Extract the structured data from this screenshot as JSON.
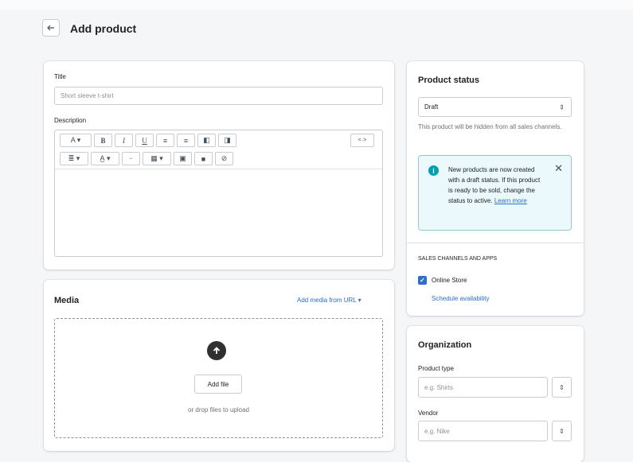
{
  "page": {
    "title": "Add product"
  },
  "product": {
    "title_label": "Title",
    "title_placeholder": "Short sleeve t-shirt",
    "description_label": "Description",
    "toolbar": {
      "row1": [
        "A ▾",
        "B",
        "I",
        "U",
        "≡",
        "≡",
        "◧",
        "◨"
      ],
      "html_toggle": "<·>",
      "row2": [
        "≣ ▾",
        "A̲ ▾",
        "⌁",
        "▦ ▾",
        "▣",
        "■",
        "⊘"
      ]
    }
  },
  "media": {
    "title": "Media",
    "add_url_link": "Add media from URL ▾",
    "add_file_button": "Add file",
    "drop_hint": "or drop files to upload"
  },
  "status": {
    "title": "Product status",
    "selected": "Draft",
    "help": "This product will be hidden from all sales channels.",
    "banner": {
      "text": "New products are now created with a draft status. If this product is ready to be sold, change the status to active.",
      "link": "Learn more"
    },
    "channels_heading": "SALES CHANNELS AND APPS",
    "channel": "Online Store",
    "channel_checked": true,
    "schedule_link": "Schedule availability"
  },
  "organization": {
    "title": "Organization",
    "product_type_label": "Product type",
    "product_type_placeholder": "e.g. Shirts",
    "vendor_label": "Vendor",
    "vendor_placeholder": "e.g. Nike"
  },
  "colors": {
    "accent": "#2c6ecb",
    "info_banner": "#ebf9fc",
    "info_icon": "#00a0ac"
  },
  "icons": [
    "arrow-left-icon",
    "info-icon",
    "close-icon",
    "upload-icon",
    "checkmark-icon",
    "select-caret-icon"
  ]
}
